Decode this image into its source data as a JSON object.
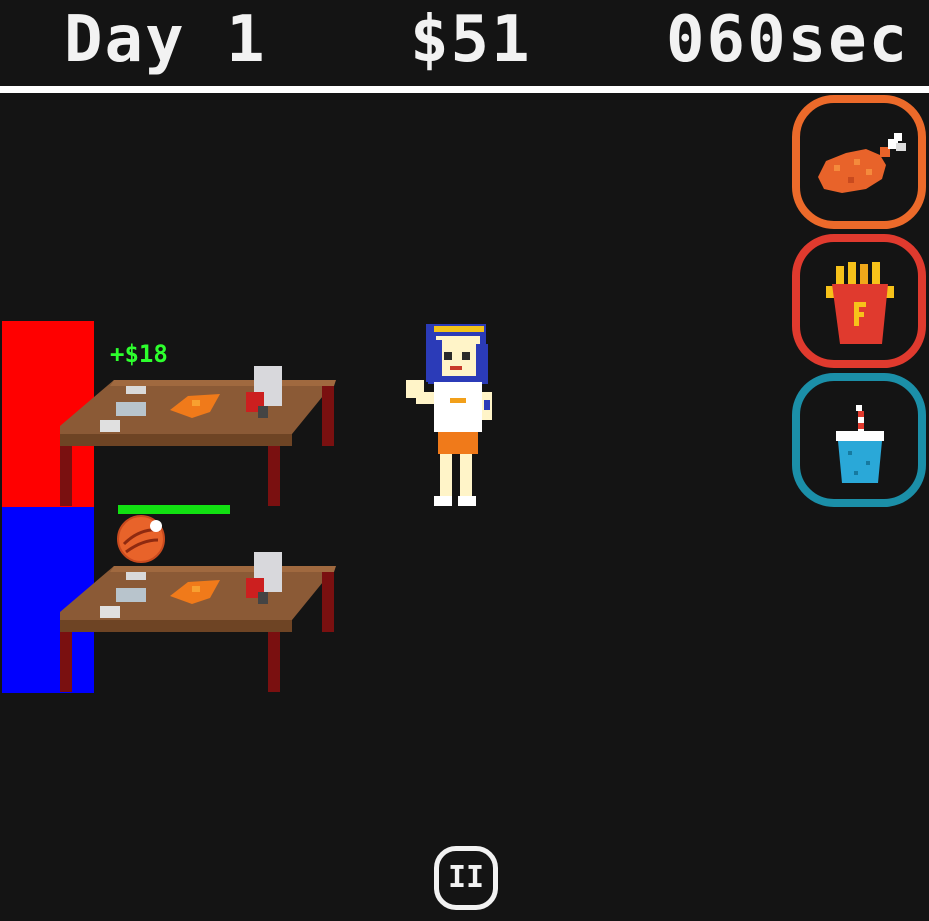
{
  "hud": {
    "day": "Day 1",
    "money": "$51",
    "timer": "060sec"
  },
  "side_menu": [
    {
      "name": "drumstick-icon",
      "accent": "#ec6a2a"
    },
    {
      "name": "fries-icon",
      "accent": "#e03a2e"
    },
    {
      "name": "drink-icon",
      "accent": "#1b8fa8"
    }
  ],
  "tables": [
    {
      "zone_color": "#ff0000",
      "earning": "+$18"
    },
    {
      "zone_color": "#0000ff",
      "order_progress": 1.0,
      "order_icon": "meat-ball-icon"
    }
  ],
  "pause_label": "II"
}
